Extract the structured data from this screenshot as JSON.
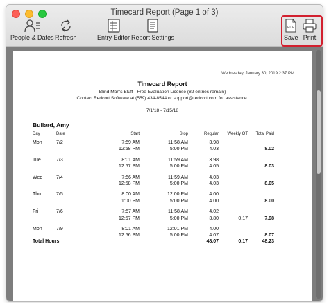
{
  "window": {
    "title": "Timecard Report  (Page 1 of 3)"
  },
  "toolbar": {
    "people_dates": "People & Dates",
    "refresh": "Refresh",
    "entry_editor": "Entry Editor",
    "report_settings": "Report Settings",
    "save": "Save",
    "print": "Print",
    "pdf_icon_text": "PDF"
  },
  "report": {
    "timestamp": "Wednesday, January 30, 2019   2:37 PM",
    "title": "Timecard Report",
    "license_line": "Blind Man's Bluff - Free Evaluation License (82 entries remain)",
    "contact_line": "Contact Redcort Software at (559) 434-8544 or support@redcort.com for assistance.",
    "date_range": "7/1/18 - 7/15/18",
    "employee": "Bullard, Amy",
    "headers": {
      "day": "Day",
      "date": "Date",
      "start": "Start",
      "stop": "Stop",
      "regular": "Regular",
      "weekly_ot": "Weekly OT",
      "total_paid": "Total Paid"
    },
    "days": [
      {
        "day": "Mon",
        "date": "7/2",
        "total": "8.02",
        "entries": [
          {
            "start": "7:59 AM",
            "stop": "11:58 AM",
            "regular": "3.98",
            "ot": ""
          },
          {
            "start": "12:58 PM",
            "stop": "5:00 PM",
            "regular": "4.03",
            "ot": ""
          }
        ]
      },
      {
        "day": "Tue",
        "date": "7/3",
        "total": "8.03",
        "entries": [
          {
            "start": "8:01 AM",
            "stop": "11:59 AM",
            "regular": "3.98",
            "ot": ""
          },
          {
            "start": "12:57 PM",
            "stop": "5:00 PM",
            "regular": "4.05",
            "ot": ""
          }
        ]
      },
      {
        "day": "Wed",
        "date": "7/4",
        "total": "8.05",
        "entries": [
          {
            "start": "7:56 AM",
            "stop": "11:59 AM",
            "regular": "4.03",
            "ot": ""
          },
          {
            "start": "12:58 PM",
            "stop": "5:00 PM",
            "regular": "4.03",
            "ot": ""
          }
        ]
      },
      {
        "day": "Thu",
        "date": "7/5",
        "total": "8.00",
        "entries": [
          {
            "start": "8:00 AM",
            "stop": "12:00 PM",
            "regular": "4.00",
            "ot": ""
          },
          {
            "start": "1:00 PM",
            "stop": "5:00 PM",
            "regular": "4.00",
            "ot": ""
          }
        ]
      },
      {
        "day": "Fri",
        "date": "7/6",
        "total": "7.98",
        "entries": [
          {
            "start": "7:57 AM",
            "stop": "11:58 AM",
            "regular": "4.02",
            "ot": ""
          },
          {
            "start": "12:57 PM",
            "stop": "5:00 PM",
            "regular": "3.80",
            "ot": "0.17"
          }
        ]
      },
      {
        "day": "Mon",
        "date": "7/9",
        "total": "8.07",
        "entries": [
          {
            "start": "8:01 AM",
            "stop": "12:01 PM",
            "regular": "4.00",
            "ot": ""
          },
          {
            "start": "12:56 PM",
            "stop": "5:00 PM",
            "regular": "4.07",
            "ot": ""
          }
        ]
      }
    ],
    "totals": {
      "label": "Total Hours",
      "regular": "48.07",
      "ot": "0.17",
      "paid": "48.23"
    }
  },
  "colors": {
    "highlight": "#d2202f",
    "content_bg": "#7d7d7d"
  }
}
